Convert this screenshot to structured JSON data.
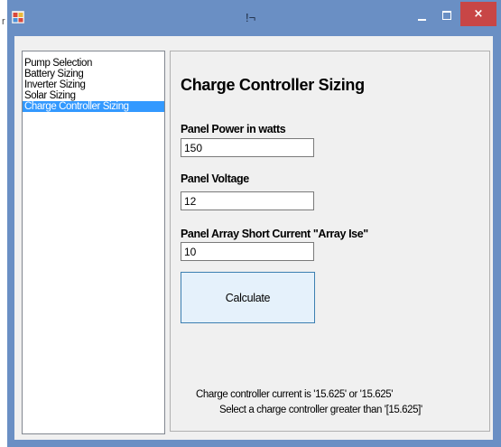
{
  "stray_mark": "r",
  "window": {
    "title": "!¬",
    "close_label": "×"
  },
  "nav": {
    "items": [
      {
        "label": "Pump Selection"
      },
      {
        "label": "Battery Sizing"
      },
      {
        "label": "Inverter Sizing"
      },
      {
        "label": "Solar Sizing"
      },
      {
        "label": "Charge Controller Sizing",
        "selected": true
      }
    ]
  },
  "form": {
    "title": "Charge Controller Sizing",
    "panel_power_label": "Panel Power in watts",
    "panel_power_value": "150",
    "panel_voltage_label": "Panel Voltage",
    "panel_voltage_value": "12",
    "short_current_label": "Panel Array Short Current \"Array Ise\"",
    "short_current_value": "10",
    "calculate_label": "Calculate"
  },
  "result": {
    "line1": "Charge controller current is '15.625' or '15.625'",
    "line2": "Select a charge controller greater than '[15.625]'"
  },
  "colors": {
    "titlebar": "#6a8fc4",
    "close_button": "#c84646",
    "selection": "#3399ff",
    "button_face": "#e5f1fb",
    "button_border": "#3c7fb1"
  },
  "icons": {
    "app": "app-window-icon",
    "minimize": "minimize-icon",
    "maximize": "maximize-icon",
    "close": "close-icon"
  }
}
